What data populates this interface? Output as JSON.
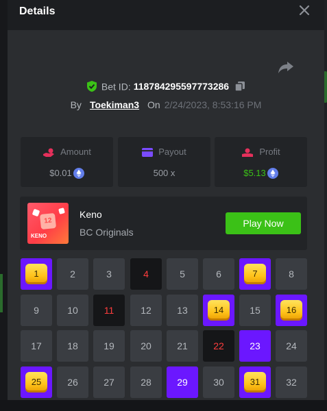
{
  "header": {
    "title": "Details"
  },
  "bet": {
    "label": "Bet ID:",
    "id": "118784295597773286",
    "by_label": "By",
    "user": "Toekiman3",
    "on_label": "On",
    "datetime": "2/24/2023, 8:53:16 PM"
  },
  "stats": {
    "amount": {
      "label": "Amount",
      "value": "$0.01"
    },
    "payout": {
      "label": "Payout",
      "value": "500 x"
    },
    "profit": {
      "label": "Profit",
      "value": "$5.13"
    }
  },
  "game": {
    "name": "Keno",
    "provider": "BC Originals",
    "thumb_number": "12",
    "thumb_brand": "KENO",
    "play_label": "Play Now"
  },
  "grid": {
    "numbers": [
      "1",
      "2",
      "3",
      "4",
      "5",
      "6",
      "7",
      "8",
      "9",
      "10",
      "11",
      "12",
      "13",
      "14",
      "15",
      "16",
      "17",
      "18",
      "19",
      "20",
      "21",
      "22",
      "23",
      "24",
      "25",
      "26",
      "27",
      "28",
      "29",
      "30",
      "31",
      "32"
    ],
    "hits": [
      1,
      7,
      14,
      16,
      25,
      31
    ],
    "picked_only": [
      23,
      29
    ],
    "misses": [
      4,
      11,
      22
    ]
  },
  "colors": {
    "accent_green": "#3bc117",
    "pick_purple": "#6b17ff",
    "miss_red": "#ff3d3d",
    "gem_gold": "#ffc21a"
  },
  "icons": {
    "close": "close-icon",
    "share": "share-arrow-icon",
    "verified": "shield-check-icon",
    "copy": "copy-icon",
    "amount": "hand-coins-icon",
    "payout": "wallet-icon",
    "profit": "profit-hand-icon",
    "currency": "ethereum-icon"
  }
}
